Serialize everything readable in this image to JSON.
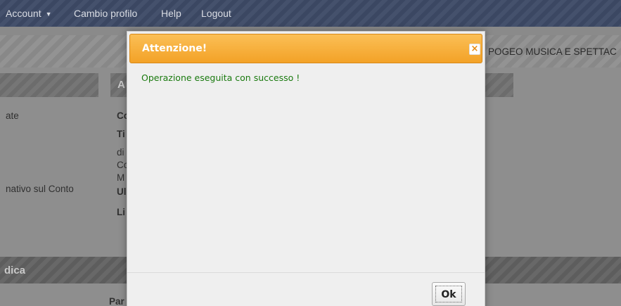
{
  "navbar": {
    "account_label": "Account",
    "account_caret": "▼",
    "change_profile_label": "Cambio profilo",
    "help_label": "Help",
    "logout_label": "Logout"
  },
  "company_name": "POGEO MUSICA E SPETTAC",
  "background": {
    "panel_right_letter": "A",
    "left_item_1": "ate",
    "left_item_2": "nativo sul Conto",
    "right_lines": [
      "Co",
      "Ti",
      "di",
      "Co",
      "M",
      "Ul",
      "Li"
    ],
    "section_title": "dica",
    "bottom_text": "Par"
  },
  "modal": {
    "title": "Attenzione!",
    "close_label": "×",
    "message": "Operazione eseguita con successo !",
    "ok_label": "Ok"
  },
  "colors": {
    "modal_header": "#f3a227",
    "message_text": "#1a7a0f",
    "navbar": "#3d4a66"
  }
}
